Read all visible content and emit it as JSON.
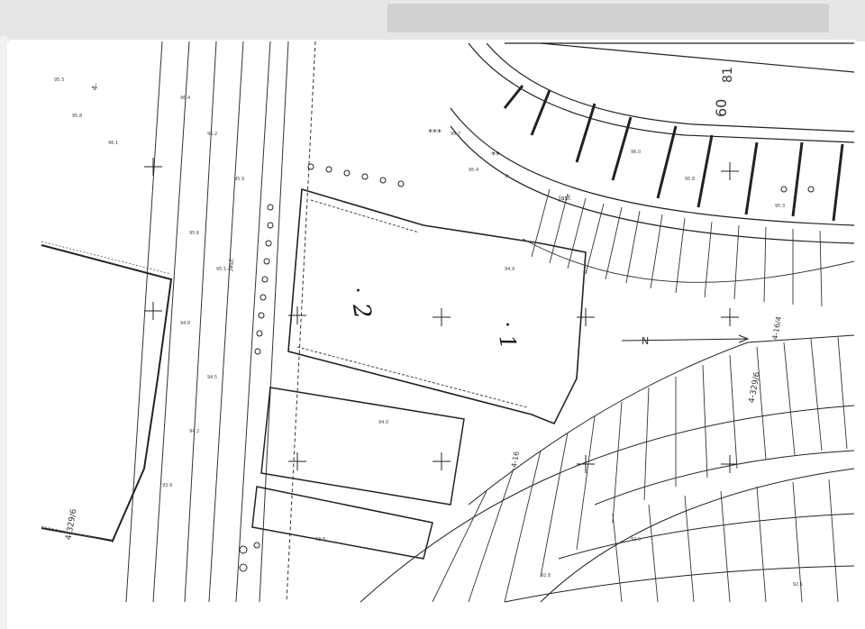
{
  "parcels": {
    "p1": "1",
    "p2": "2"
  },
  "labels": {
    "hyphen_note": "4-",
    "left_code": "4-329/6",
    "right_code": "4-329/6",
    "r1": "4-16/4",
    "r2": "4-16",
    "ch1": "60",
    "ch2": "81",
    "arrow": "N",
    "jasf": "Jasf.",
    "jasf2": "Jasf."
  },
  "colors": {
    "ink": "#2a2a2a",
    "paper": "#ffffff",
    "shadow": "#cfcfcf"
  }
}
